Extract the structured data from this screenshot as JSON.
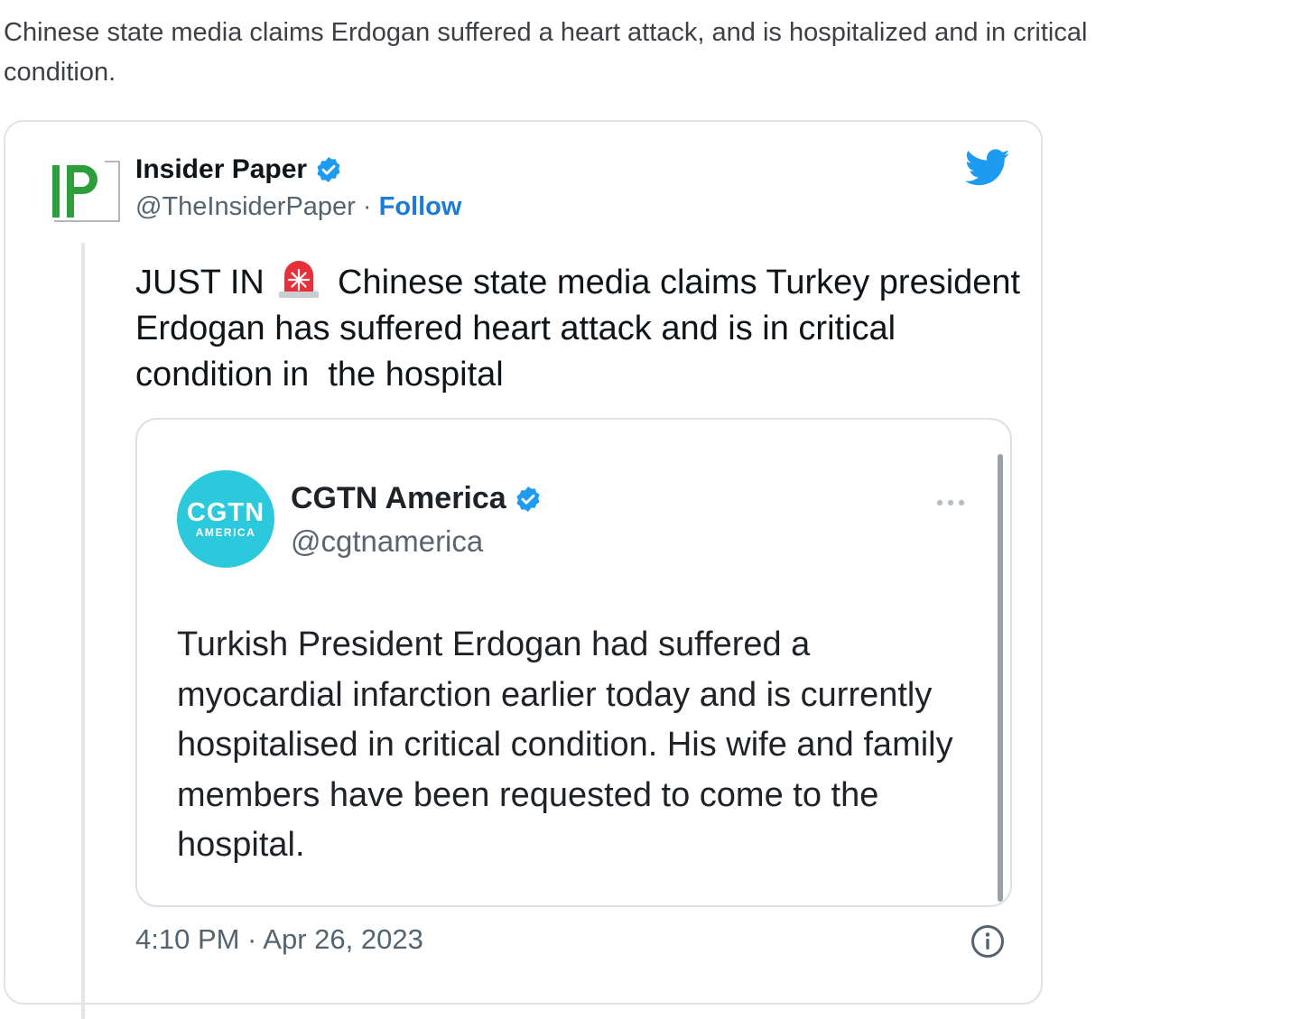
{
  "post": {
    "caption": "Chinese state media claims Erdogan suffered a heart attack, and is hospitalized and in critical condition."
  },
  "tweet": {
    "author_logo_text": "IP",
    "author_name": "Insider Paper",
    "handle": "@TheInsiderPaper",
    "separator": " · ",
    "follow_label": "Follow",
    "text_prefix": "JUST IN ",
    "text_body": " Chinese state media claims Turkey president Erdogan has suffered heart attack and is in critical condition in  the hospital",
    "siren_icon": "rotating-light-icon",
    "timestamp": "4:10 PM · Apr 26, 2023",
    "icons": {
      "verified": "verified-badge-icon",
      "bird": "twitter-bird-icon",
      "info": "info-icon"
    },
    "colors": {
      "link": "#1d7bd8",
      "verified": "#1d9bf0",
      "logo_green": "#2e9e3c"
    }
  },
  "quote": {
    "avatar_text_big": "CGTN",
    "avatar_text_small": "AMERICA",
    "author_name": "CGTN America",
    "handle": "@cgtnamerica",
    "text": "Turkish President Erdogan had suffered a myocardial infarction earlier today and is currently hospitalised in critical condition. His wife and family members have been requested to come to the hospital.",
    "more_icon": "more-options-icon",
    "colors": {
      "avatar_bg": "#2cc9dc"
    }
  }
}
